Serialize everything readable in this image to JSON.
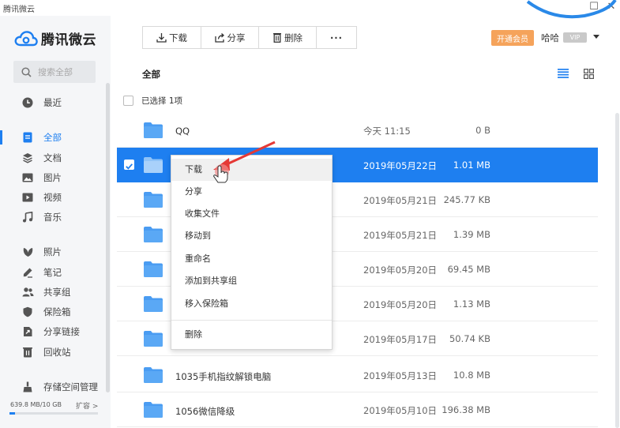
{
  "window": {
    "title": "腾讯微云",
    "min": "—",
    "max": "☐",
    "close": "✕"
  },
  "sidebar": {
    "logo_text": "腾讯微云",
    "search_placeholder": "搜索全部",
    "items": [
      {
        "label": "最近",
        "icon": "clock-icon",
        "active": false
      },
      {
        "label": "全部",
        "icon": "file-icon",
        "active": true
      },
      {
        "label": "文档",
        "icon": "layers-icon",
        "active": false
      },
      {
        "label": "图片",
        "icon": "image-icon",
        "active": false
      },
      {
        "label": "视频",
        "icon": "play-icon",
        "active": false
      },
      {
        "label": "音乐",
        "icon": "music-icon",
        "active": false
      },
      {
        "label": "照片",
        "icon": "leaf-icon",
        "active": false
      },
      {
        "label": "笔记",
        "icon": "pen-icon",
        "active": false
      },
      {
        "label": "共享组",
        "icon": "users-icon",
        "active": false
      },
      {
        "label": "保险箱",
        "icon": "shield-icon",
        "active": false
      },
      {
        "label": "分享链接",
        "icon": "share-link-icon",
        "active": false
      },
      {
        "label": "回收站",
        "icon": "trash-icon",
        "active": false
      }
    ],
    "storage": {
      "label": "存储空间管理",
      "usage": "639.8 MB/10 GB",
      "expand": "扩容 >",
      "used_fraction": 0.062
    }
  },
  "toolbar": {
    "download": "下载",
    "share": "分享",
    "delete": "删除",
    "more": "···",
    "vip": "开通会员",
    "username": "哈哈",
    "vip_badge": "VIP"
  },
  "main": {
    "breadcrumb": "全部",
    "selected_text": "已选择 1项",
    "files": [
      {
        "name": "QQ",
        "date": "今天 11:15",
        "size": "0 B",
        "selected": false
      },
      {
        "name": "",
        "date": "2019年05月22日",
        "size": "1.01 MB",
        "selected": true
      },
      {
        "name": "",
        "date": "2019年05月21日",
        "size": "245.77 KB",
        "selected": false
      },
      {
        "name": "",
        "date": "2019年05月21日",
        "size": "1.39 MB",
        "selected": false
      },
      {
        "name": "",
        "date": "2019年05月20日",
        "size": "69.45 MB",
        "selected": false
      },
      {
        "name": "",
        "date": "2019年05月20日",
        "size": "1.13 MB",
        "selected": false
      },
      {
        "name": "",
        "date": "2019年05月17日",
        "size": "50.74 KB",
        "selected": false
      },
      {
        "name": "1035手机指纹解锁电脑",
        "date": "2019年05月13日",
        "size": "10.8 MB",
        "selected": false
      },
      {
        "name": "1056微信降级",
        "date": "2019年05月10日",
        "size": "196.38 MB",
        "selected": false
      }
    ]
  },
  "context_menu": {
    "items": [
      "下载",
      "分享",
      "收集文件",
      "移动到",
      "重命名",
      "添加到共享组",
      "移入保险箱"
    ],
    "delete": "删除"
  },
  "colors": {
    "accent": "#1e7ff0",
    "vip": "#f5a35b",
    "annotation": "#e53935",
    "folder": "#4a9cf2"
  }
}
